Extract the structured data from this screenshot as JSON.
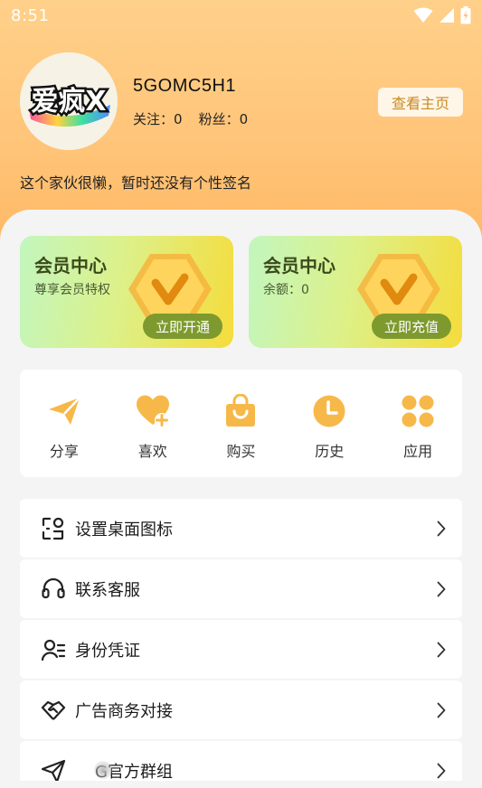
{
  "status_bar": {
    "time": "8:51",
    "icons": [
      "wifi-icon",
      "signal-icon",
      "battery-charging-icon"
    ]
  },
  "profile": {
    "avatar_text": "爱疯X",
    "username": "5GOMC5H1",
    "follow_label": "关注：",
    "follow_count": "0",
    "fans_label": "粉丝：",
    "fans_count": "0",
    "home_button": "查看主页",
    "signature": "这个家伙很懒，暂时还没有个性签名"
  },
  "vip_cards": [
    {
      "title": "会员中心",
      "subtitle": "尊享会员特权",
      "button": "立即开通"
    },
    {
      "title": "会员中心",
      "subtitle": "余额：0",
      "button": "立即充值"
    }
  ],
  "quick_actions": [
    {
      "label": "分享",
      "icon": "paper-plane-icon"
    },
    {
      "label": "喜欢",
      "icon": "heart-plus-icon"
    },
    {
      "label": "购买",
      "icon": "shopping-bag-icon"
    },
    {
      "label": "历史",
      "icon": "clock-icon"
    },
    {
      "label": "应用",
      "icon": "apps-grid-icon"
    }
  ],
  "menu": [
    {
      "label": "设置桌面图标",
      "icon": "desktop-icon-settings-icon"
    },
    {
      "label": "联系客服",
      "icon": "headset-icon"
    },
    {
      "label": "身份凭证",
      "icon": "id-card-icon"
    },
    {
      "label": "广告商务对接",
      "icon": "handshake-icon"
    },
    {
      "label": "G官方群组",
      "icon": "send-icon"
    }
  ],
  "colors": {
    "header_gradient_top": "#ffd08a",
    "header_gradient_bottom": "#ffb560",
    "accent_orange": "#f7b84a",
    "vip_button": "#7e9a2e",
    "home_button_text": "#c98a22"
  }
}
